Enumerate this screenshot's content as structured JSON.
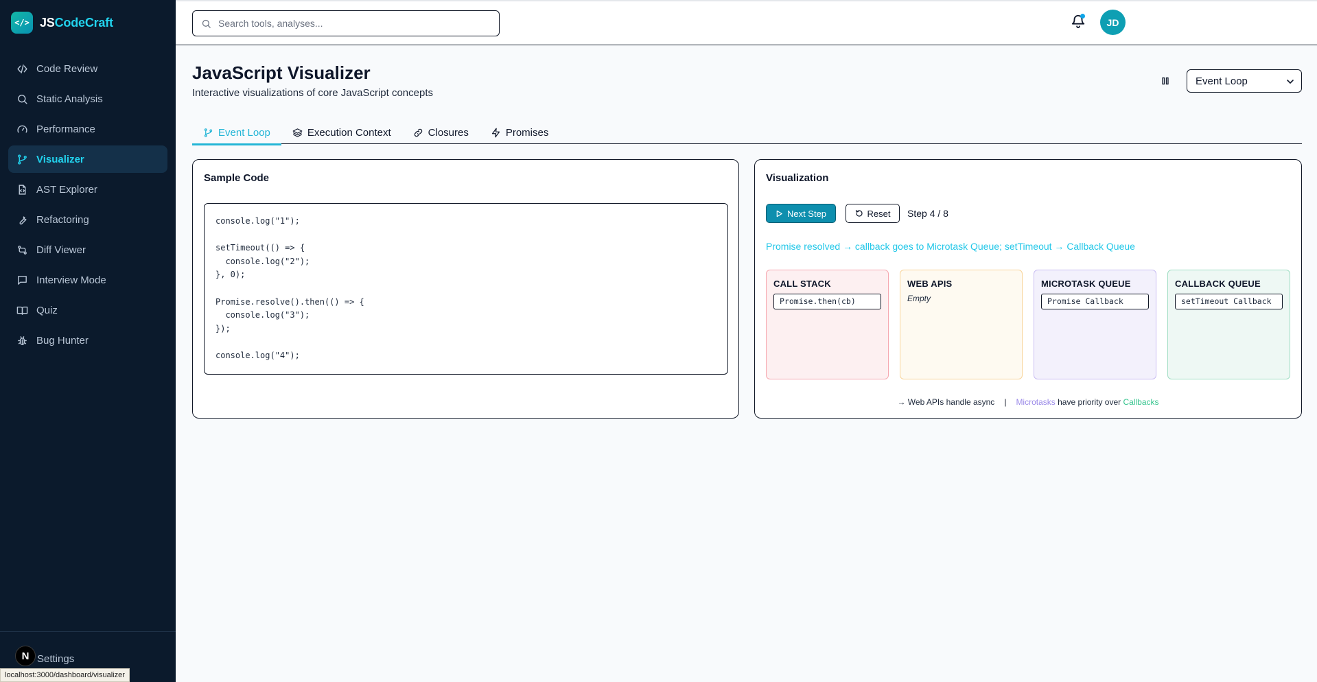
{
  "brand": {
    "prefix": "JS",
    "suffix": "CodeCraft",
    "logo_glyph": "</>"
  },
  "sidebar": {
    "items": [
      {
        "label": "Code Review",
        "icon": "code-icon",
        "active": false
      },
      {
        "label": "Static Analysis",
        "icon": "search-icon",
        "active": false
      },
      {
        "label": "Performance",
        "icon": "gauge-icon",
        "active": false
      },
      {
        "label": "Visualizer",
        "icon": "git-branch-icon",
        "active": true
      },
      {
        "label": "AST Explorer",
        "icon": "file-code-icon",
        "active": false
      },
      {
        "label": "Refactoring",
        "icon": "wrench-icon",
        "active": false
      },
      {
        "label": "Diff Viewer",
        "icon": "git-compare-icon",
        "active": false
      },
      {
        "label": "Interview Mode",
        "icon": "message-square-icon",
        "active": false
      },
      {
        "label": "Quiz",
        "icon": "book-open-icon",
        "active": false
      },
      {
        "label": "Bug Hunter",
        "icon": "bug-icon",
        "active": false
      }
    ],
    "settings_label": "Settings",
    "n_badge": "N",
    "status_url": "localhost:3000/dashboard/visualizer"
  },
  "header": {
    "search_placeholder": "Search tools, analyses...",
    "avatar_initials": "JD"
  },
  "page": {
    "title": "JavaScript Visualizer",
    "subtitle": "Interactive visualizations of core JavaScript concepts",
    "select_value": "Event Loop",
    "tabs": [
      {
        "label": "Event Loop",
        "icon": "git-branch-icon",
        "active": true
      },
      {
        "label": "Execution Context",
        "icon": "layers-icon",
        "active": false
      },
      {
        "label": "Closures",
        "icon": "link-icon",
        "active": false
      },
      {
        "label": "Promises",
        "icon": "zap-icon",
        "active": false
      }
    ]
  },
  "code_card": {
    "title": "Sample Code",
    "lines": [
      "console.log(\"1\");",
      "",
      "setTimeout(() => {",
      "  console.log(\"2\");",
      "}, 0);",
      "",
      "Promise.resolve().then(() => {",
      "  console.log(\"3\");",
      "});",
      "",
      "console.log(\"4\");"
    ]
  },
  "vis_card": {
    "title": "Visualization",
    "next_label": "Next Step",
    "reset_label": "Reset",
    "step_label": "Step 4 / 8",
    "explanation": "Promise resolved → callback goes to Microtask Queue; setTimeout → Callback Queue",
    "queues": {
      "call_stack": {
        "title": "CALL STACK",
        "items": [
          "Promise.then(cb)"
        ]
      },
      "web_apis": {
        "title": "WEB APIS",
        "empty": "Empty"
      },
      "microtask": {
        "title": "MICROTASK QUEUE",
        "items": [
          "Promise Callback"
        ]
      },
      "callback": {
        "title": "CALLBACK QUEUE",
        "items": [
          "setTimeout Callback"
        ]
      }
    },
    "legend": {
      "left": "→ Web APIs handle async",
      "micro": "Microtasks",
      "middle": " have priority over ",
      "cb": "Callbacks"
    }
  },
  "colors": {
    "sidebar_bg": "#0b1a2c",
    "accent": "#22b5d6",
    "primary_button": "#0e8fae"
  }
}
